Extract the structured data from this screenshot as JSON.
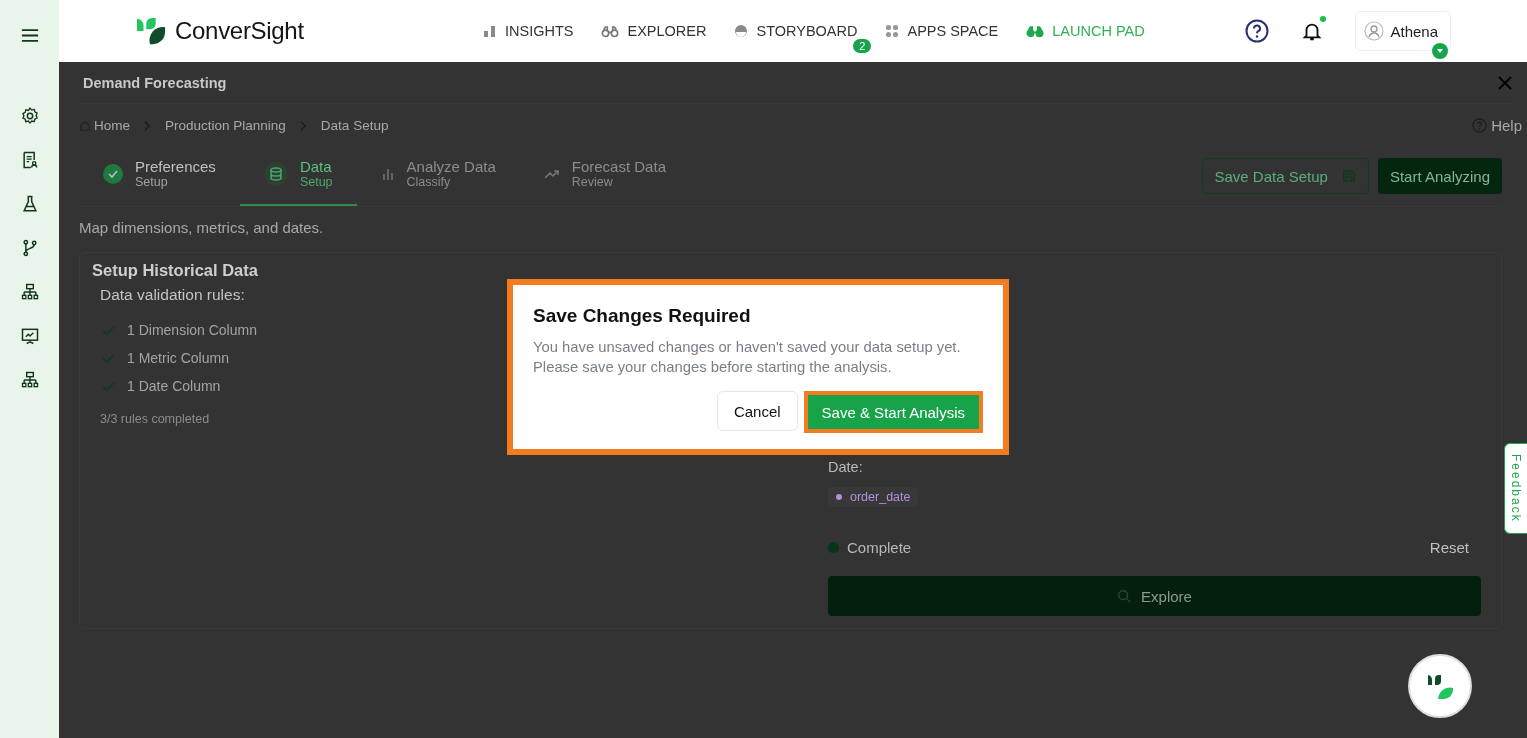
{
  "brand": {
    "name": "ConverSight"
  },
  "nav": [
    {
      "label": "INSIGHTS",
      "selected": false
    },
    {
      "label": "EXPLORER",
      "selected": false
    },
    {
      "label": "STORYBOARD",
      "selected": false,
      "badge": "2"
    },
    {
      "label": "APPS SPACE",
      "selected": false
    },
    {
      "label": "LAUNCH PAD",
      "selected": true
    }
  ],
  "notifications": {
    "unread": true
  },
  "user": {
    "name": "Athena"
  },
  "page": {
    "title": "Demand Forecasting",
    "breadcrumb": [
      "Home",
      "Production Planning",
      "Data Setup"
    ],
    "help": "Help"
  },
  "steps": [
    {
      "title": "Preferences",
      "subtitle": "Setup",
      "kind": "check",
      "completed": true,
      "selected": false
    },
    {
      "title": "Data",
      "subtitle": "Setup",
      "kind": "database",
      "completed": false,
      "selected": true
    },
    {
      "title": "Analyze Data",
      "subtitle": "Classify",
      "kind": "bars",
      "completed": false,
      "selected": false
    },
    {
      "title": "Forecast Data",
      "subtitle": "Review",
      "kind": "trend",
      "completed": false,
      "selected": false
    }
  ],
  "actions": {
    "save": "Save Data Setup",
    "start": "Start Analyzing"
  },
  "subtitle": "Map dimensions, metrics, and dates.",
  "card": {
    "title": "Setup Historical Data",
    "rules_heading": "Data validation rules:",
    "rules": [
      {
        "label": "1 Dimension Column",
        "checked": true
      },
      {
        "label": "1 Metric Column",
        "checked": true
      },
      {
        "label": "1 Date Column",
        "checked": true
      }
    ],
    "rules_count": "3/3 rules completed",
    "date_label": "Date:",
    "date_tag": "order_date",
    "status": "Complete",
    "reset": "Reset",
    "explore": "Explore"
  },
  "dialog": {
    "title": "Save Changes Required",
    "message": "You have unsaved changes or haven't saved your data setup yet. Please save your changes before starting the analysis.",
    "cancel": "Cancel",
    "confirm": "Save & Start Analysis"
  },
  "feedback": "Feedback"
}
